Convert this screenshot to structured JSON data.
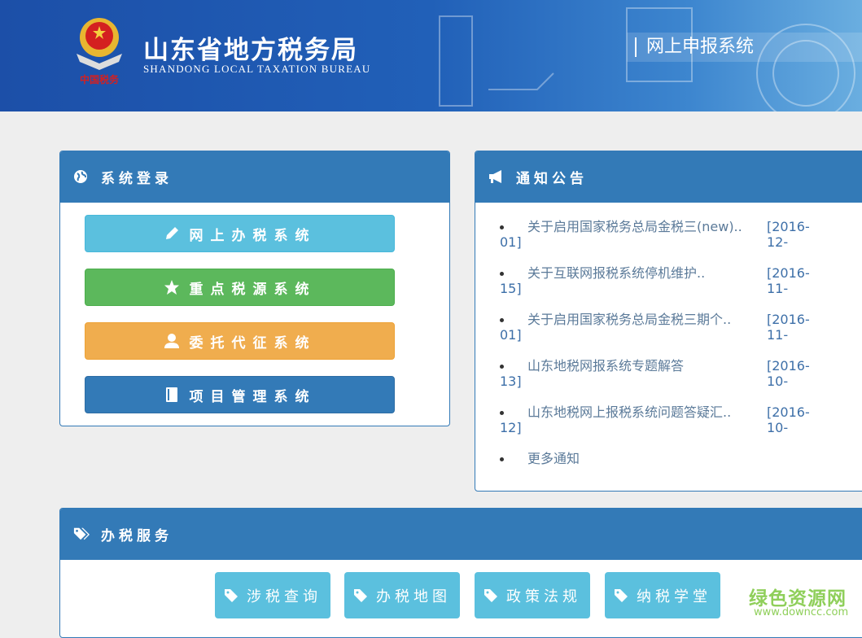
{
  "header": {
    "title": "山东省地方税务局",
    "subtitle": "SHANDONG LOCAL TAXATION BUREAU",
    "emblem_text": "中国税务",
    "system_name": "网上申报系统"
  },
  "login": {
    "title": "系统登录",
    "buttons": [
      {
        "label": "网上办税系统",
        "icon": "pencil-icon",
        "color": "#5bc0de"
      },
      {
        "label": "重点税源系统",
        "icon": "star-icon",
        "color": "#5cb85c"
      },
      {
        "label": "委托代征系统",
        "icon": "user-icon",
        "color": "#f0ad4e"
      },
      {
        "label": "项目管理系统",
        "icon": "book-icon",
        "color": "#337ab7"
      }
    ]
  },
  "notices": {
    "title": "通知公告",
    "items": [
      {
        "title": "关于启用国家税务总局金税三(new)..",
        "date_a": "[2016-12-",
        "date_b": "01]"
      },
      {
        "title": "关于互联网报税系统停机维护..",
        "date_a": "[2016-11-",
        "date_b": "15]"
      },
      {
        "title": "关于启用国家税务总局金税三期个..",
        "date_a": "[2016-11-",
        "date_b": "01]"
      },
      {
        "title": "山东地税网报系统专题解答",
        "date_a": "[2016-10-",
        "date_b": "13]"
      },
      {
        "title": "山东地税网上报税系统问题答疑汇..",
        "date_a": "[2016-10-",
        "date_b": "12]"
      }
    ],
    "more": "更多通知"
  },
  "services": {
    "title": "办税服务",
    "items": [
      {
        "label": "涉税查询"
      },
      {
        "label": "办税地图"
      },
      {
        "label": "政策法规"
      },
      {
        "label": "纳税学堂"
      }
    ]
  },
  "watermark": {
    "name": "绿色资源网",
    "url": "www.downcc.com"
  }
}
